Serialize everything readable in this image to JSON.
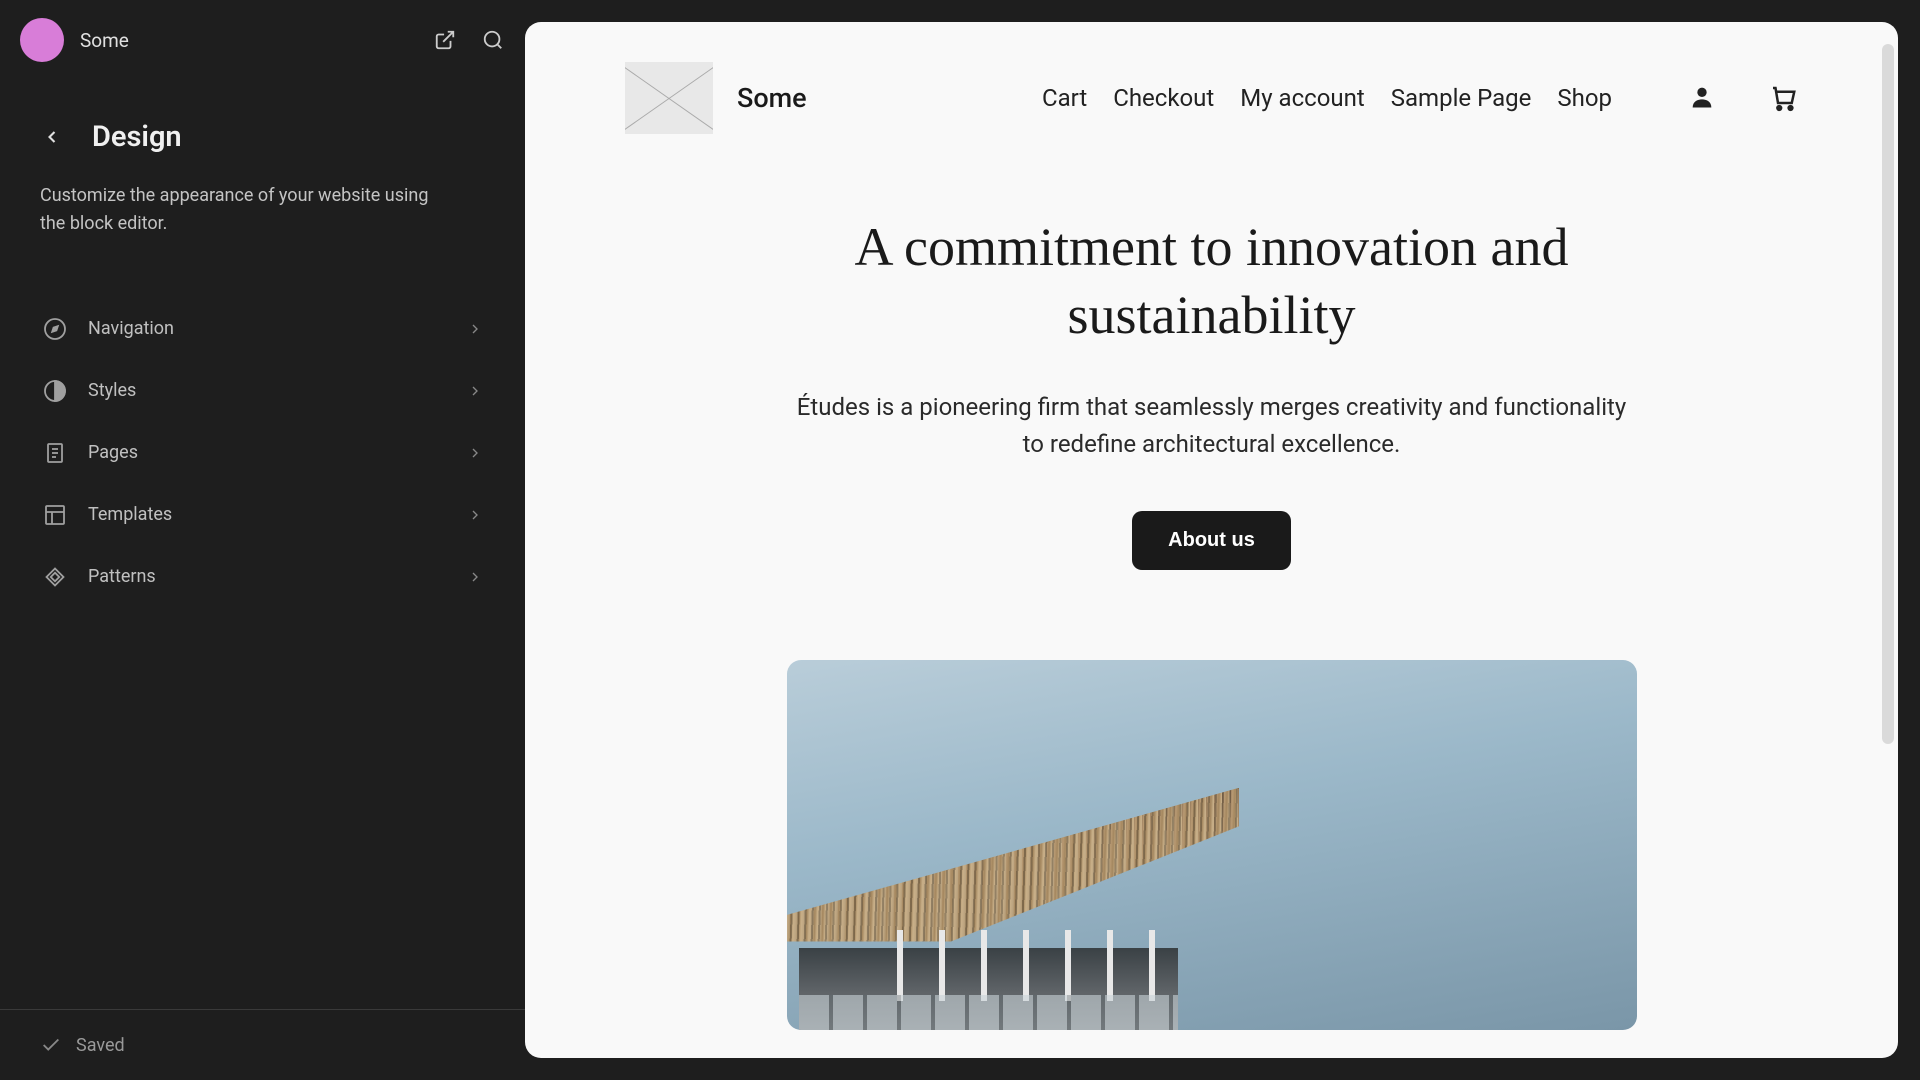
{
  "sidebar": {
    "site_name": "Some",
    "title": "Design",
    "description": "Customize the appearance of your website using the block editor.",
    "menu": [
      {
        "label": "Navigation",
        "icon": "compass-icon"
      },
      {
        "label": "Styles",
        "icon": "half-circle-icon"
      },
      {
        "label": "Pages",
        "icon": "page-icon"
      },
      {
        "label": "Templates",
        "icon": "layout-icon"
      },
      {
        "label": "Patterns",
        "icon": "diamond-icon"
      }
    ],
    "footer_status": "Saved"
  },
  "preview": {
    "site_title": "Some",
    "nav": [
      {
        "label": "Cart"
      },
      {
        "label": "Checkout"
      },
      {
        "label": "My account"
      },
      {
        "label": "Sample Page"
      },
      {
        "label": "Shop"
      }
    ],
    "hero_title": "A commitment to innovation and sustainability",
    "hero_subtitle": "Études is a pioneering firm that seamlessly merges creativity and functionality to redefine architectural excellence.",
    "hero_button": "About us"
  }
}
